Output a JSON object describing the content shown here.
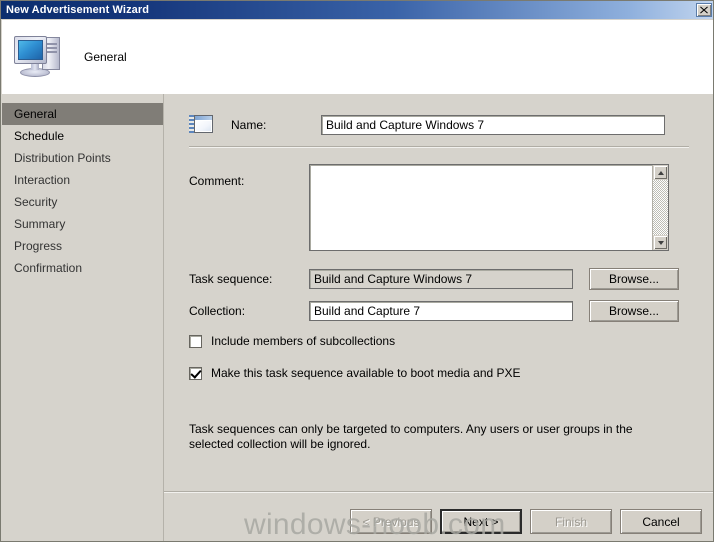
{
  "window": {
    "title": "New Advertisement Wizard",
    "close_label": "×"
  },
  "header": {
    "title": "General",
    "icon": "computer-icon"
  },
  "sidebar": {
    "items": [
      {
        "label": "General",
        "selected": true
      },
      {
        "label": "Schedule",
        "selected": false
      },
      {
        "label": "Distribution Points",
        "selected": false
      },
      {
        "label": "Interaction",
        "selected": false
      },
      {
        "label": "Security",
        "selected": false
      },
      {
        "label": "Summary",
        "selected": false
      },
      {
        "label": "Progress",
        "selected": false
      },
      {
        "label": "Confirmation",
        "selected": false
      }
    ]
  },
  "form": {
    "name_label": "Name:",
    "name_value": "Build and Capture Windows 7",
    "comment_label": "Comment:",
    "comment_value": "",
    "task_sequence_label": "Task sequence:",
    "task_sequence_value": "Build and Capture Windows 7",
    "task_sequence_browse": "Browse...",
    "collection_label": "Collection:",
    "collection_value": "Build and Capture 7",
    "collection_browse": "Browse...",
    "include_subcollections_label": "Include members of subcollections",
    "include_subcollections_checked": false,
    "boot_media_label": "Make this task sequence available to boot media and PXE",
    "boot_media_checked": true,
    "info_text": "Task sequences can only be targeted to computers.  Any users or user groups in the selected collection will be ignored."
  },
  "footer": {
    "previous_label": "< Previous",
    "next_label": "Next >",
    "finish_label": "Finish",
    "cancel_label": "Cancel"
  },
  "watermark": {
    "text": "windows-noob.com"
  }
}
